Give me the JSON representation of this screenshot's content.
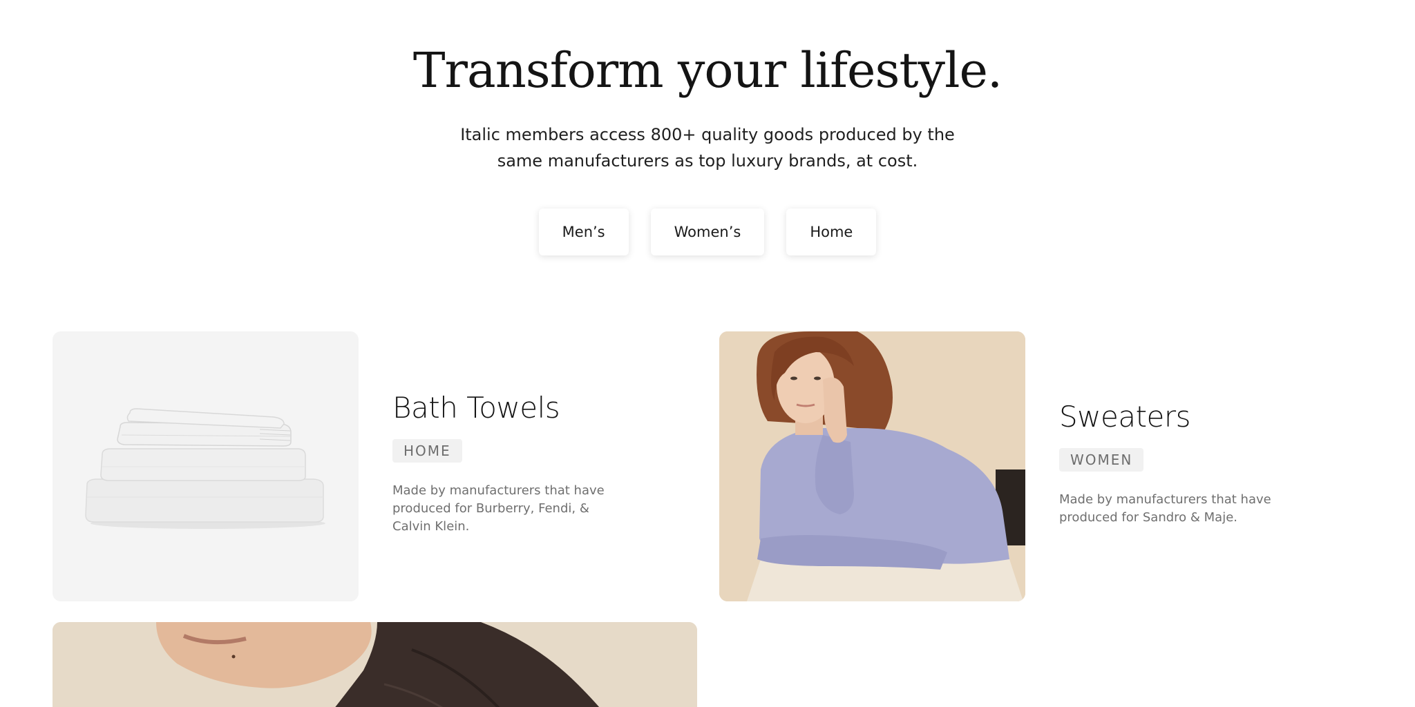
{
  "hero": {
    "title": "Transform your lifestyle.",
    "subtitle_line1": "Italic members access 800+ quality goods produced by the",
    "subtitle_line2": "same manufacturers as top luxury brands, at cost."
  },
  "categories": [
    {
      "label": "Men’s"
    },
    {
      "label": "Women’s"
    },
    {
      "label": "Home"
    }
  ],
  "products": [
    {
      "title": "Bath Towels",
      "tag": "HOME",
      "description": "Made by manufacturers that have produced for Burberry, Fendi, & Calvin Klein."
    },
    {
      "title": "Sweaters",
      "tag": "WOMEN",
      "description": "Made by manufacturers that have produced for Sandro & Maje."
    }
  ],
  "colors": {
    "text": "#141414",
    "muted": "#6f6f6f",
    "tag_bg": "#f1f1f1",
    "towel_bg": "#f4f4f4",
    "sweater_bg": "#e8d6bd",
    "sweater_color": "#a7a9d0",
    "jacket_bg": "#e6dac8"
  }
}
